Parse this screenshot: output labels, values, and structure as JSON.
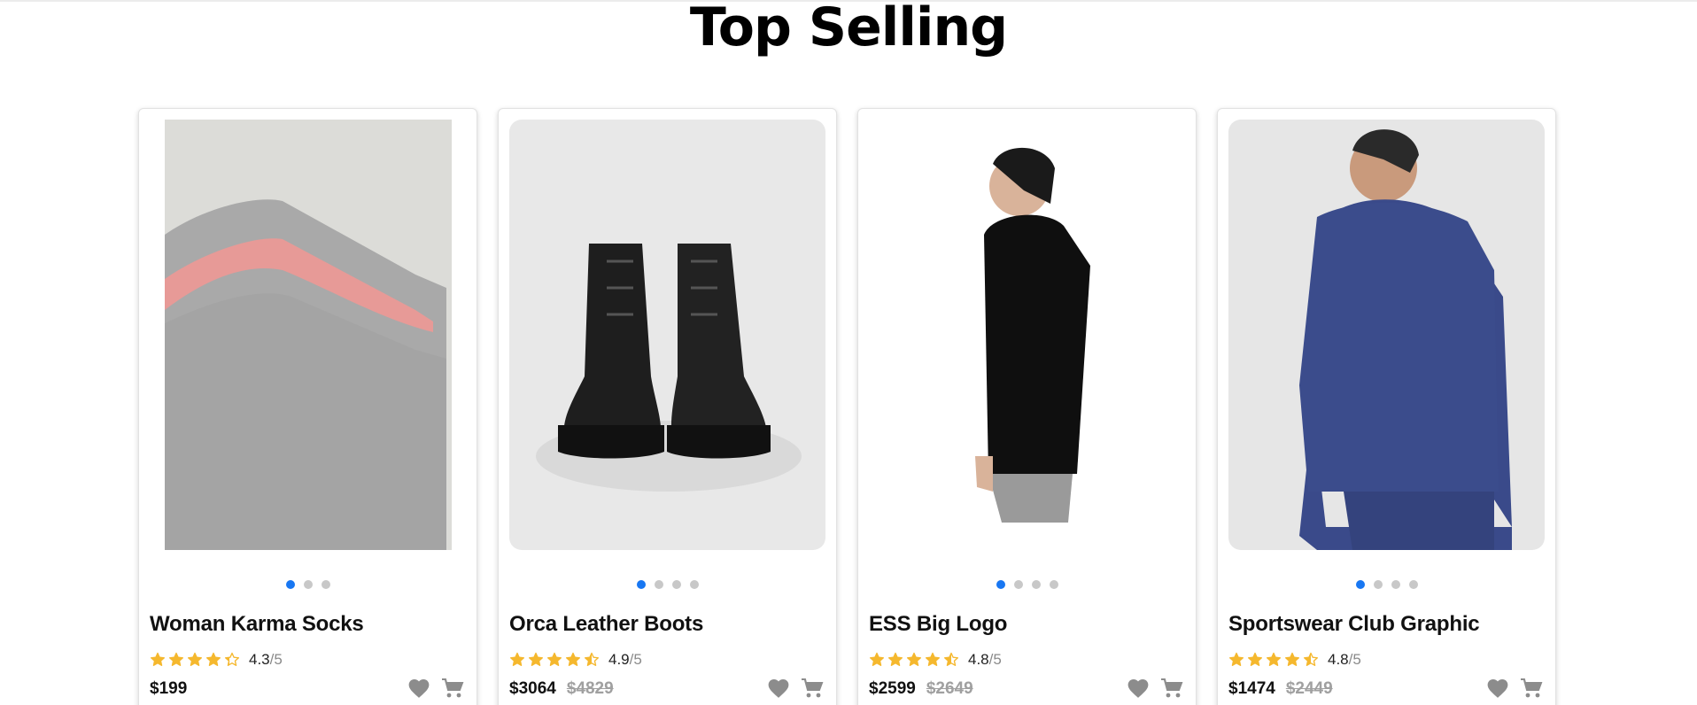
{
  "section": {
    "title": "Top Selling"
  },
  "colors": {
    "accent": "#1877f2",
    "star": "#f5b82e",
    "action_icon": "#8c8c8c"
  },
  "products": [
    {
      "name": "Woman Karma Socks",
      "rating": "4.3",
      "rating_max": "/5",
      "stars": 4.3,
      "price": "$199",
      "old_price": "",
      "dots": 3,
      "active_dot": 0,
      "image": "socks"
    },
    {
      "name": "Orca Leather Boots",
      "rating": "4.9",
      "rating_max": "/5",
      "stars": 4.5,
      "price": "$3064",
      "old_price": "$4829",
      "dots": 4,
      "active_dot": 0,
      "image": "boots"
    },
    {
      "name": "ESS Big Logo",
      "rating": "4.8",
      "rating_max": "/5",
      "stars": 4.5,
      "price": "$2599",
      "old_price": "$2649",
      "dots": 4,
      "active_dot": 0,
      "image": "hoodie-black"
    },
    {
      "name": "Sportswear Club Graphic",
      "rating": "4.8",
      "rating_max": "/5",
      "stars": 4.5,
      "price": "$1474",
      "old_price": "$2449",
      "dots": 4,
      "active_dot": 0,
      "image": "hoodie-navy"
    }
  ]
}
